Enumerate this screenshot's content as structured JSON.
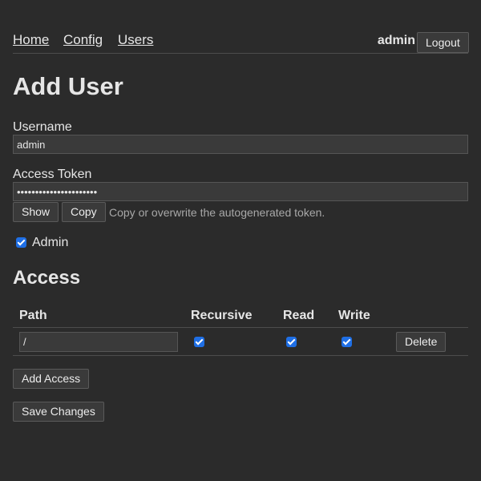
{
  "nav": {
    "links": [
      "Home",
      "Config",
      "Users"
    ],
    "current_user": "admin",
    "logout_label": "Logout"
  },
  "page": {
    "title": "Add User"
  },
  "form": {
    "username_label": "Username",
    "username_value": "admin",
    "token_label": "Access Token",
    "token_value": "••••••••••••••••••••••",
    "show_label": "Show",
    "copy_label": "Copy",
    "token_hint": "Copy or overwrite the autogenerated token.",
    "admin_label": "Admin",
    "admin_checked": true
  },
  "access": {
    "heading": "Access",
    "columns": [
      "Path",
      "Recursive",
      "Read",
      "Write"
    ],
    "rows": [
      {
        "path": "/",
        "recursive": true,
        "read": true,
        "write": true,
        "delete_label": "Delete"
      }
    ],
    "add_label": "Add Access"
  },
  "save_label": "Save Changes",
  "colors": {
    "background": "#2b2b2b",
    "text": "#e6e6e6",
    "checkbox": "#1f6fe5"
  }
}
